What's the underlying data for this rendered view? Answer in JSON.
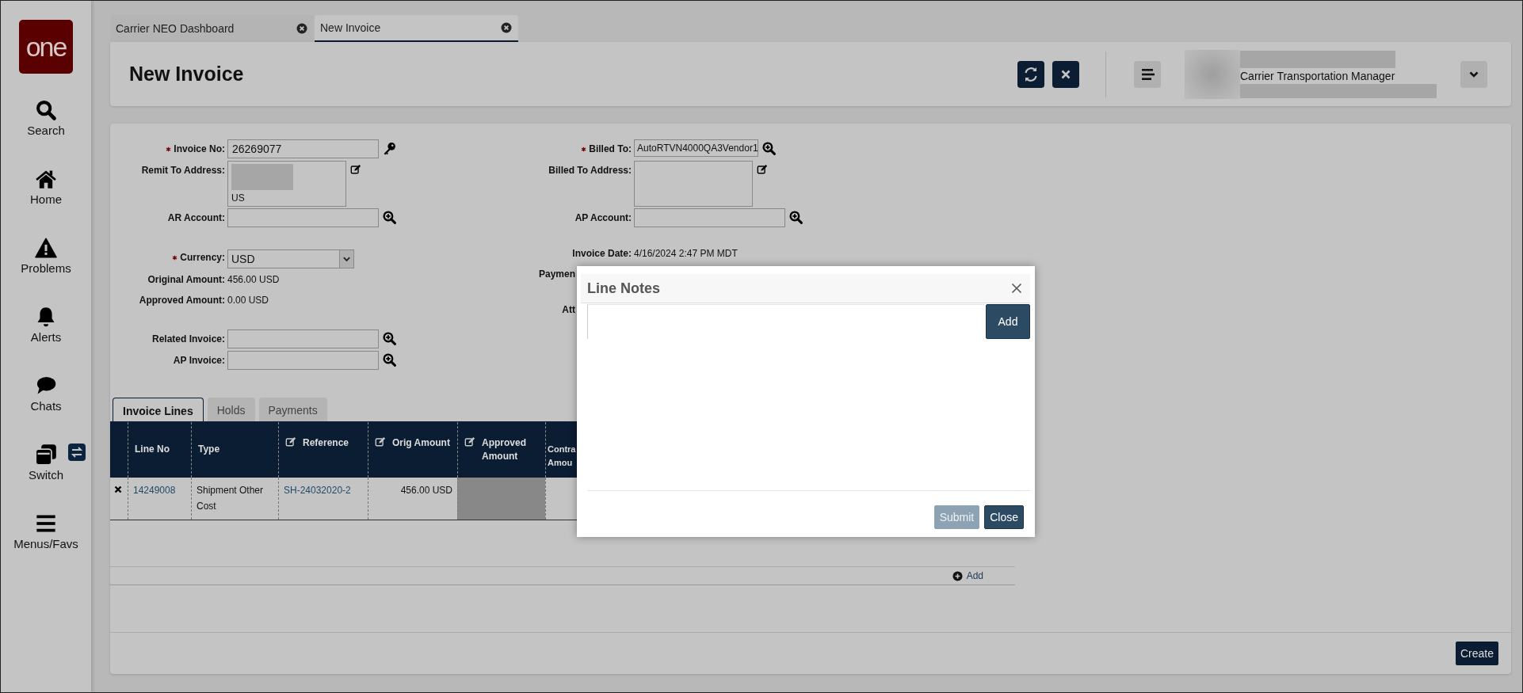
{
  "logo": {
    "text": "one"
  },
  "sidebar": {
    "items": [
      {
        "kind": "search",
        "label": "Search"
      },
      {
        "kind": "home",
        "label": "Home"
      },
      {
        "kind": "problems",
        "label": "Problems"
      },
      {
        "kind": "alerts",
        "label": "Alerts"
      },
      {
        "kind": "chats",
        "label": "Chats"
      },
      {
        "kind": "switch",
        "label": "Switch"
      },
      {
        "kind": "menus",
        "label": "Menus/Favs"
      }
    ]
  },
  "tabs": [
    {
      "label": "Carrier NEO Dashboard",
      "selected": false
    },
    {
      "label": "New Invoice",
      "selected": true
    }
  ],
  "header": {
    "title": "New Invoice",
    "user_role": "Carrier Transportation Manager"
  },
  "form": {
    "left": [
      [
        {
          "kind": "id",
          "label": "Invoice No:",
          "required": true,
          "value": "26269077"
        },
        {
          "kind": "address",
          "label": "Remit To Address:",
          "required": false,
          "lines": [
            "US"
          ],
          "redacted": true
        },
        {
          "kind": "text",
          "label": "AR Account:",
          "required": false
        }
      ],
      [
        {
          "kind": "select",
          "label": "Currency:",
          "required": true,
          "value": "USD"
        },
        {
          "kind": "readonly",
          "label": "Original Amount:",
          "required": false,
          "value": "456.00 USD"
        },
        {
          "kind": "readonly",
          "label": "Approved Amount:",
          "required": false,
          "value": "0.00 USD"
        }
      ],
      [
        {
          "kind": "text",
          "label": "Related Invoice:",
          "required": false
        },
        {
          "kind": "text",
          "label": "AP Invoice:",
          "required": false
        }
      ]
    ],
    "right": [
      [
        {
          "kind": "tag",
          "label": "Billed To:",
          "required": true,
          "value": "AutoRTVN4000QA3Vendor1"
        },
        {
          "kind": "address",
          "label": "Billed To Address:",
          "required": false,
          "redacted": false
        },
        {
          "kind": "text",
          "label": "AP Account:",
          "required": false
        }
      ],
      [
        {
          "kind": "readonly",
          "label": "Invoice Date:",
          "required": false,
          "value": "4/16/2024 2:47 PM MDT"
        },
        {
          "kind": "partial",
          "label": "Paymen",
          "required": false
        }
      ],
      [
        {
          "kind": "partial",
          "label": "Att",
          "required": false
        }
      ]
    ]
  },
  "line_tabs": [
    {
      "label": "Invoice Lines",
      "selected": true
    },
    {
      "label": "Holds",
      "selected": false
    },
    {
      "label": "Payments",
      "selected": false
    }
  ],
  "table": {
    "columns": [
      {
        "label": "Line No",
        "editable": false,
        "shaded": false
      },
      {
        "label": "Type",
        "editable": false,
        "shaded": false
      },
      {
        "label": "Reference",
        "editable": true,
        "shaded": false
      },
      {
        "label": "Orig Amount",
        "editable": true,
        "shaded": false
      },
      {
        "label": "Approved Amount",
        "editable": true,
        "shaded": true
      },
      {
        "label": "Contra Amou",
        "editable": false,
        "shaded": false
      }
    ],
    "rows": [
      {
        "cells": [
          "14249008",
          "Shipment Other Cost",
          "SH-24032020-2",
          "456.00 USD"
        ]
      }
    ]
  },
  "add_link": "Add",
  "create_button": "Create",
  "modal": {
    "title": "Line Notes",
    "add_button": "Add",
    "buttons": [
      {
        "label": "Submit",
        "disabled": true
      },
      {
        "label": "Close",
        "disabled": false
      }
    ]
  }
}
